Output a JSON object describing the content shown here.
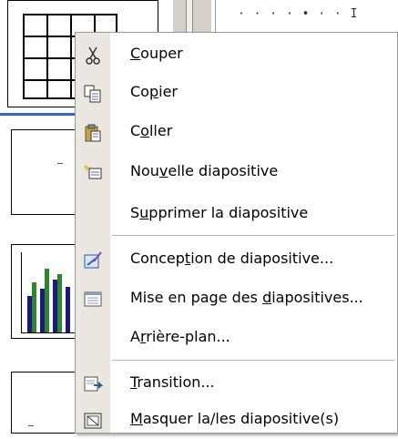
{
  "menu": {
    "items": [
      {
        "id": "couper",
        "pre": "",
        "acc": "C",
        "post": "ouper",
        "icon": "scissors-icon"
      },
      {
        "id": "copier",
        "pre": "Co",
        "acc": "p",
        "post": "ier",
        "icon": "copy-icon"
      },
      {
        "id": "coller",
        "pre": "C",
        "acc": "o",
        "post": "ller",
        "icon": "paste-icon"
      },
      {
        "id": "nouvelle",
        "pre": "Nou",
        "acc": "v",
        "post": "elle diapositive",
        "icon": "new-slide-icon"
      },
      {
        "id": "supprimer",
        "pre": "S",
        "acc": "u",
        "post": "pprimer la diapositive",
        "icon": ""
      },
      {
        "id": "conception",
        "pre": "Concep",
        "acc": "t",
        "post": "ion de diapositive...",
        "icon": "design-icon"
      },
      {
        "id": "mise",
        "pre": "Mise en page des ",
        "acc": "d",
        "post": "iapositives...",
        "icon": "layout-icon"
      },
      {
        "id": "arriere",
        "pre": "A",
        "acc": "r",
        "post": "rière-plan...",
        "icon": ""
      },
      {
        "id": "transition",
        "pre": "",
        "acc": "T",
        "post": "ransition...",
        "icon": "transition-icon"
      },
      {
        "id": "masquer",
        "pre": "",
        "acc": "M",
        "post": "asquer la/les diapositive(s)",
        "icon": "hide-slide-icon"
      }
    ]
  },
  "background": {
    "ruler_text": "· · · · • · · I"
  },
  "colors": {
    "selection_blue": "#316ac5",
    "menu_gutter": "#e9e7e0"
  }
}
